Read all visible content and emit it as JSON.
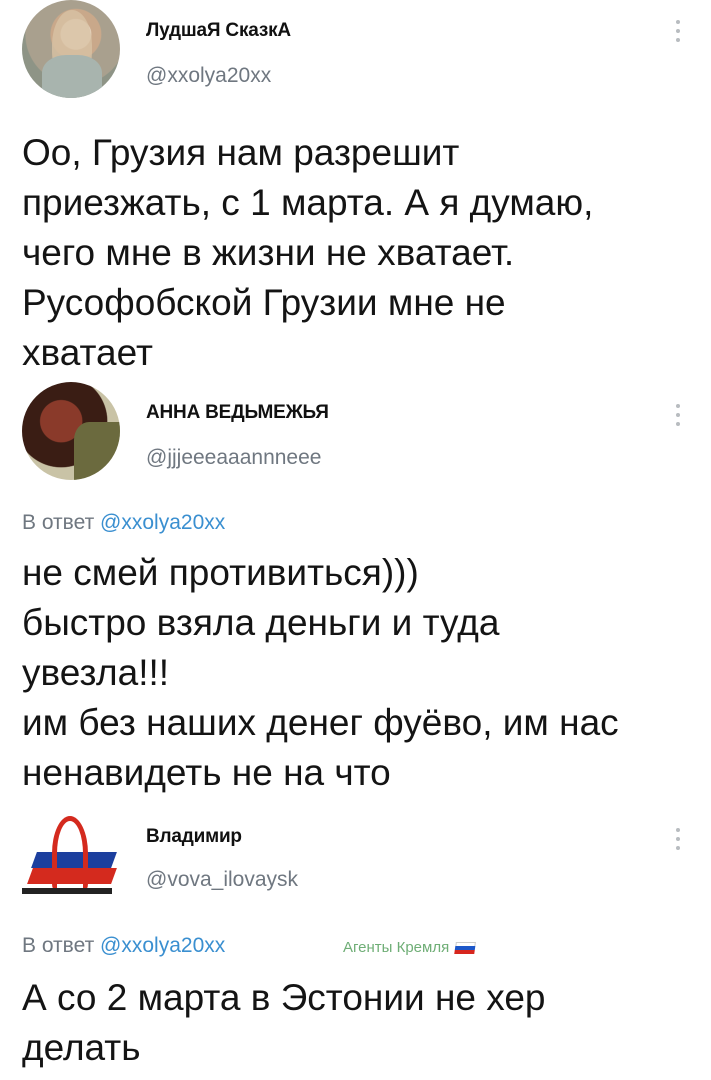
{
  "tweets": [
    {
      "author_name": "ЛудшаЯ СказкА",
      "author_handle": "@xxolya20xx",
      "text": "Оо, Грузия нам разрешит\nприезжать, с 1 марта. А я думаю,\nчего мне в жизни не хватает.\nРусофобской Грузии мне не\nхватает"
    },
    {
      "author_name": "АННА ВЕДЬМЕЖЬЯ",
      "author_handle": "@jjjeeeaaannneee",
      "reply_prefix": "В ответ",
      "reply_mention": "@xxolya20xx",
      "text": "не смей противиться)))\nбыстро взяла деньги и туда\nувезла!!!\nим без наших денег фуёво, им нас\nненавидеть не на что"
    },
    {
      "author_name": "Владимир",
      "author_handle": "@vova_ilovaysk",
      "reply_prefix": "В ответ",
      "reply_mention": "@xxolya20xx",
      "label": "Агенты Кремля",
      "text": "А со 2 марта в Эстонии не хер\nделать"
    }
  ],
  "icons": {
    "more": "more-vertical-icon",
    "flag": "russian-flag-icon"
  },
  "colors": {
    "mention": "#3a8fd0",
    "muted": "#6f7780",
    "label": "#6fae76"
  }
}
